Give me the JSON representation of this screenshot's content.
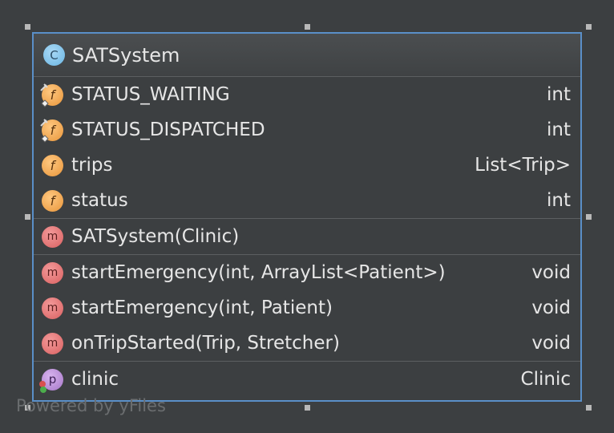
{
  "class": {
    "name": "SATSystem",
    "icon": "class-c-icon",
    "icon_letter": "C"
  },
  "fields": [
    {
      "name": "STATUS_WAITING",
      "type": "int",
      "icon": "static-final-field-icon",
      "icon_letter": "f"
    },
    {
      "name": "STATUS_DISPATCHED",
      "type": "int",
      "icon": "static-final-field-icon",
      "icon_letter": "f"
    },
    {
      "name": "trips",
      "type": "List<Trip>",
      "icon": "field-icon",
      "icon_letter": "f"
    },
    {
      "name": "status",
      "type": "int",
      "icon": "field-icon",
      "icon_letter": "f"
    }
  ],
  "constructors": [
    {
      "name": "SATSystem(Clinic)",
      "type": "",
      "icon": "method-icon",
      "icon_letter": "m"
    }
  ],
  "methods": [
    {
      "name": "startEmergency(int, ArrayList<Patient>)",
      "type": "void",
      "icon": "method-icon",
      "icon_letter": "m"
    },
    {
      "name": "startEmergency(int, Patient)",
      "type": "void",
      "icon": "method-icon",
      "icon_letter": "m"
    },
    {
      "name": "onTripStarted(Trip, Stretcher)",
      "type": "void",
      "icon": "method-icon",
      "icon_letter": "m"
    }
  ],
  "properties": [
    {
      "name": "clinic",
      "type": "Clinic",
      "icon": "property-icon",
      "icon_letter": "p"
    }
  ],
  "watermark": "Powered by yFiles",
  "colors": {
    "background": "#3c3f41",
    "selection_border": "#5a8fc8",
    "text": "#e6e6e6"
  }
}
